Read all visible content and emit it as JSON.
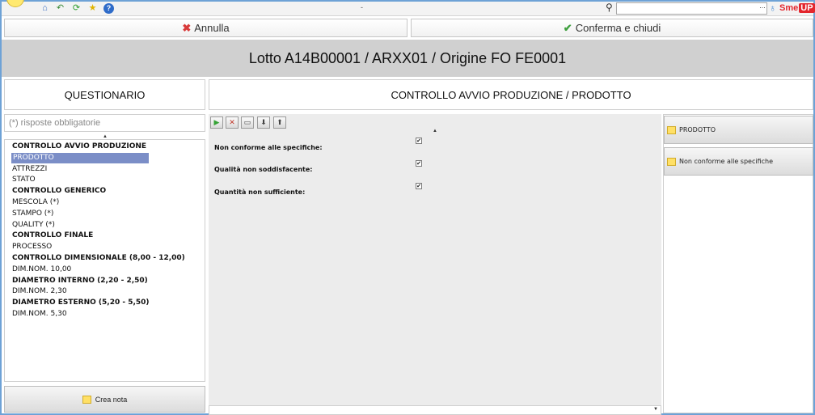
{
  "toolbar": {
    "center_text": "-",
    "search_value": "",
    "dots_label": "...",
    "brand_text": "Sme",
    "brand_badge": "UP"
  },
  "actions": {
    "cancel_label": "Annulla",
    "confirm_label": "Conferma e chiudi"
  },
  "page_title": "Lotto A14B00001 / ARXX01 / Origine FO FE0001",
  "left_panel": {
    "header": "QUESTIONARIO",
    "required_placeholder": "(*) risposte obbligatorie",
    "tree": [
      {
        "label": "CONTROLLO AVVIO PRODUZIONE",
        "group": true,
        "selected": false
      },
      {
        "label": "PRODOTTO",
        "group": false,
        "selected": true
      },
      {
        "label": "ATTREZZI",
        "group": false,
        "selected": false
      },
      {
        "label": "STATO",
        "group": false,
        "selected": false
      },
      {
        "label": "CONTROLLO GENERICO",
        "group": true,
        "selected": false
      },
      {
        "label": "MESCOLA (*)",
        "group": false,
        "selected": false
      },
      {
        "label": "STAMPO (*)",
        "group": false,
        "selected": false
      },
      {
        "label": "QUALITY (*)",
        "group": false,
        "selected": false
      },
      {
        "label": "CONTROLLO FINALE",
        "group": true,
        "selected": false
      },
      {
        "label": "PROCESSO",
        "group": false,
        "selected": false
      },
      {
        "label": "CONTROLLO DIMENSIONALE (8,00 - 12,00)",
        "group": true,
        "selected": false
      },
      {
        "label": "DIM.NOM. 10,00",
        "group": false,
        "selected": false
      },
      {
        "label": "DIAMETRO INTERNO (2,20 - 2,50)",
        "group": true,
        "selected": false
      },
      {
        "label": "DIM.NOM. 2,30",
        "group": false,
        "selected": false
      },
      {
        "label": "DIAMETRO ESTERNO (5,20 - 5,50)",
        "group": true,
        "selected": false
      },
      {
        "label": "DIM.NOM. 5,30",
        "group": false,
        "selected": false
      }
    ],
    "note_button": "Crea nota"
  },
  "center_panel": {
    "header": "CONTROLLO AVVIO PRODUZIONE / PRODOTTO",
    "questions": [
      {
        "label": "Non conforme alle specifiche:",
        "checked": true
      },
      {
        "label": "Qualità non soddisfacente:",
        "checked": true
      },
      {
        "label": "Quantità non sufficiente:",
        "checked": true
      }
    ]
  },
  "right_panel": {
    "items": [
      "PRODOTTO",
      "Non conforme alle specifiche"
    ]
  },
  "colors": {
    "selection": "#7b8ec7",
    "title_band": "#d0d0d0",
    "cancel_icon": "#d83a3a",
    "confirm_icon": "#3fa03f",
    "note_icon": "#ffe066",
    "frame": "#6ea2d6"
  }
}
